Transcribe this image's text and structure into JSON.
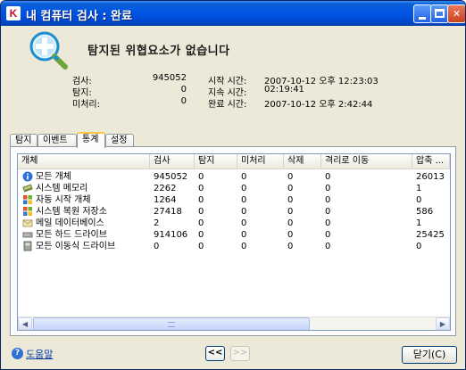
{
  "window": {
    "title": "내 컴퓨터 검사 : 완료",
    "app_icon_letter": "K"
  },
  "header": {
    "icon": "magnifier-scan-icon",
    "title": "탐지된 위협요소가 없습니다"
  },
  "stats": {
    "scanned_label": "검사:",
    "scanned_value": "945052",
    "detected_label": "탐지:",
    "detected_value": "0",
    "untreated_label": "미처리:",
    "untreated_value": "0",
    "start_label": "시작 시간:",
    "start_value": "2007-10-12 오후 12:23:03",
    "duration_label": "지속 시간:",
    "duration_value": "02:19:41",
    "end_label": "완료 시간:",
    "end_value": "2007-10-12 오후 2:42:44"
  },
  "tabs": [
    {
      "label": "탐지"
    },
    {
      "label": "이벤트"
    },
    {
      "label": "통계"
    },
    {
      "label": "설정"
    }
  ],
  "table": {
    "columns": [
      "개체",
      "검사",
      "탐지",
      "미처리",
      "삭제",
      "격리로 이동",
      "압축 ..."
    ],
    "rows": [
      {
        "icon": "info-icon",
        "name": "모든 개체",
        "scanned": "945052",
        "detected": "0",
        "untreated": "0",
        "deleted": "0",
        "quarantined": "0",
        "archives": "26013"
      },
      {
        "icon": "memory-chip-icon",
        "name": "시스템 메모리",
        "scanned": "2262",
        "detected": "0",
        "untreated": "0",
        "deleted": "0",
        "quarantined": "0",
        "archives": "1"
      },
      {
        "icon": "windows-flag-icon",
        "name": "자동 시작 개체",
        "scanned": "1264",
        "detected": "0",
        "untreated": "0",
        "deleted": "0",
        "quarantined": "0",
        "archives": "0"
      },
      {
        "icon": "windows-flag-icon",
        "name": "시스템 복원 저장소",
        "scanned": "27418",
        "detected": "0",
        "untreated": "0",
        "deleted": "0",
        "quarantined": "0",
        "archives": "586"
      },
      {
        "icon": "mail-icon",
        "name": "메일 데이터베이스",
        "scanned": "2",
        "detected": "0",
        "untreated": "0",
        "deleted": "0",
        "quarantined": "0",
        "archives": "1"
      },
      {
        "icon": "hard-drive-icon",
        "name": "모든 하드 드라이브",
        "scanned": "914106",
        "detected": "0",
        "untreated": "0",
        "deleted": "0",
        "quarantined": "0",
        "archives": "25425"
      },
      {
        "icon": "removable-drive-icon",
        "name": "모든 이동식 드라이브",
        "scanned": "0",
        "detected": "0",
        "untreated": "0",
        "deleted": "0",
        "quarantined": "0",
        "archives": "0"
      }
    ]
  },
  "footer": {
    "help_label": "도움말",
    "prev_label": "<<",
    "next_label": ">>",
    "close_label": "닫기(C)"
  }
}
